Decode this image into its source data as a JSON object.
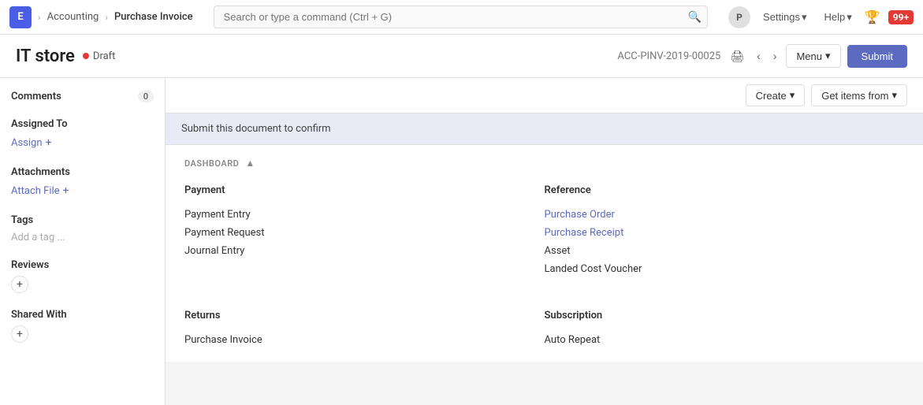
{
  "app": {
    "icon_label": "E",
    "breadcrumb": [
      {
        "label": "Accounting",
        "active": false
      },
      {
        "label": "Purchase Invoice",
        "active": true
      }
    ]
  },
  "navbar": {
    "search_placeholder": "Search or type a command (Ctrl + G)",
    "avatar_label": "P",
    "settings_label": "Settings",
    "help_label": "Help",
    "badge_count": "99+"
  },
  "page_header": {
    "doc_title": "IT store",
    "status_label": "Draft",
    "doc_id": "ACC-PINV-2019-00025",
    "menu_label": "Menu",
    "submit_label": "Submit"
  },
  "sidebar": {
    "comments_label": "Comments",
    "comments_count": "0",
    "assigned_to_label": "Assigned To",
    "assign_label": "Assign",
    "attachments_label": "Attachments",
    "attach_file_label": "Attach File",
    "tags_label": "Tags",
    "add_tag_label": "Add a tag ...",
    "reviews_label": "Reviews",
    "shared_with_label": "Shared With"
  },
  "toolbar": {
    "create_label": "Create",
    "get_items_label": "Get items from"
  },
  "notice": {
    "text": "Submit this document to confirm"
  },
  "dashboard": {
    "section_label": "DASHBOARD",
    "payment": {
      "title": "Payment",
      "items": [
        {
          "label": "Payment Entry",
          "is_link": false
        },
        {
          "label": "Payment Request",
          "is_link": false
        },
        {
          "label": "Journal Entry",
          "is_link": false
        }
      ]
    },
    "reference": {
      "title": "Reference",
      "items": [
        {
          "label": "Purchase Order",
          "is_link": true
        },
        {
          "label": "Purchase Receipt",
          "is_link": true
        },
        {
          "label": "Asset",
          "is_link": false
        },
        {
          "label": "Landed Cost Voucher",
          "is_link": false
        }
      ]
    },
    "returns": {
      "title": "Returns",
      "items": [
        {
          "label": "Purchase Invoice",
          "is_link": false
        }
      ]
    },
    "subscription": {
      "title": "Subscription",
      "items": [
        {
          "label": "Auto Repeat",
          "is_link": false
        }
      ]
    }
  }
}
